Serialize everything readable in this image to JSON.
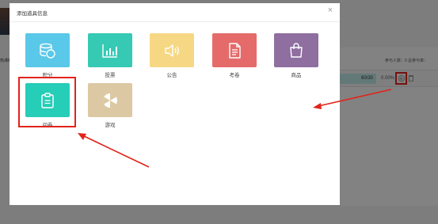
{
  "background": {
    "left_text": "热课程",
    "stats_text": "参与人数：0    总参与率：",
    "progress_value": "60/30",
    "percent": "0.00%"
  },
  "dialog": {
    "title": "添加道具信息",
    "close_glyph": "×",
    "items": [
      {
        "label": "积分",
        "color": "#5ac8e8",
        "icon": "coins-icon"
      },
      {
        "label": "投票",
        "color": "#36c9b4",
        "icon": "bar-chart-icon"
      },
      {
        "label": "公告",
        "color": "#f6d884",
        "icon": "speaker-icon"
      },
      {
        "label": "考卷",
        "color": "#e56b6a",
        "icon": "document-icon"
      },
      {
        "label": "商品",
        "color": "#8e6fa0",
        "icon": "shopping-bag-icon"
      },
      {
        "label": "问卷",
        "color": "#26cdb7",
        "icon": "clipboard-icon"
      },
      {
        "label": "游戏",
        "color": "#dcc8a2",
        "icon": "wheel-icon"
      }
    ]
  },
  "annotation_color": "#e2231a"
}
